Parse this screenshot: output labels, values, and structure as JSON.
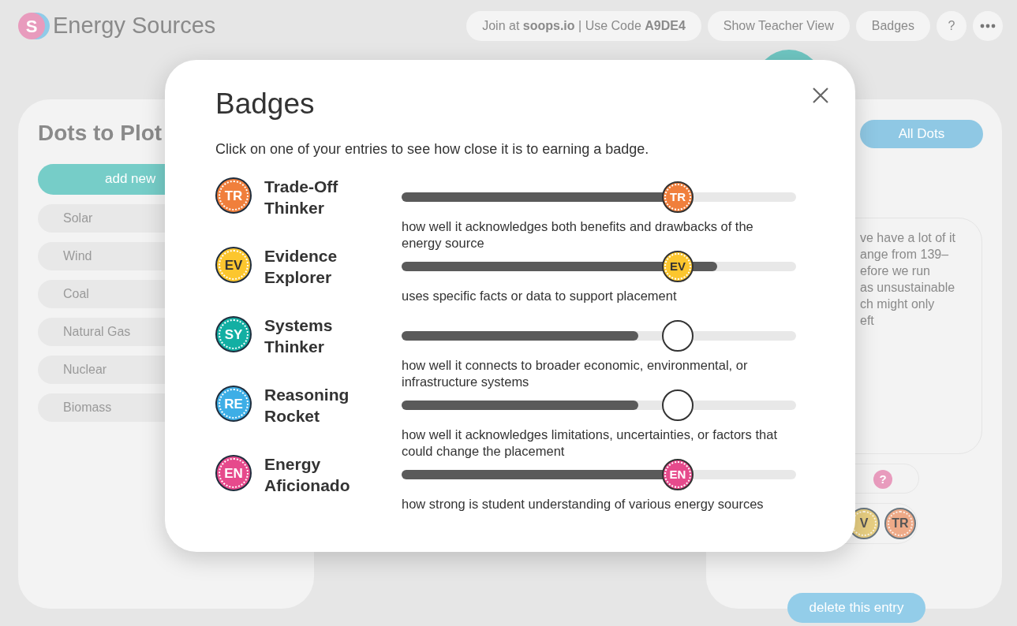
{
  "app": {
    "logo_letter": "S",
    "title": "Energy Sources"
  },
  "header_buttons": [
    {
      "kind": "join",
      "text": "Join at **soops.io** | Use Code **A9DE4**"
    },
    {
      "kind": "pill",
      "text": "Show Teacher View"
    },
    {
      "kind": "pill",
      "text": "Badges"
    },
    {
      "kind": "round",
      "text": "?"
    },
    {
      "kind": "more"
    }
  ],
  "left_panel": {
    "title": "Dots to Plot",
    "add_button": "add new",
    "items": [
      "Solar",
      "Wind",
      "Coal",
      "Natural Gas",
      "Nuclear",
      "Biomass"
    ]
  },
  "right_panel": {
    "filter_button": "All Dots",
    "note_lines": [
      "ve have a lot of it",
      "ange from 139–",
      "efore we run",
      "as unsustainable",
      "ch might only",
      "eft"
    ],
    "help_icon": "?",
    "badge_tokens": [
      {
        "initials": "V",
        "color": "#e8cf82"
      },
      {
        "initials": "TR",
        "color": "#eeaa88"
      }
    ],
    "delete_button": "delete this entry"
  },
  "modal": {
    "title": "Badges",
    "subtitle": "Click on one of your entries to see how close it is to earning a badge.",
    "badges": [
      {
        "initials": "TR",
        "name": "Trade-Off Thinker",
        "color": "#f07f3c",
        "level": 0.7,
        "goal": {
          "level": 0.7,
          "earned": true,
          "text": "TR"
        },
        "description": "how well it acknowledges both benefits and drawbacks of the energy source"
      },
      {
        "initials": "EV",
        "name": "Evidence Explorer",
        "color": "#fcc62e",
        "level": 0.8,
        "goal": {
          "level": 0.7,
          "earned": true,
          "text": "EV"
        },
        "description": "uses specific facts or data to support placement"
      },
      {
        "initials": "SY",
        "name": "Systems Thinker",
        "color": "#13afa3",
        "level": 0.6,
        "goal": {
          "level": 0.7,
          "earned": false
        },
        "description": "how well it connects to broader economic, environmental, or infrastructure systems"
      },
      {
        "initials": "RE",
        "name": "Reasoning Rocket",
        "color": "#3daee6",
        "level": 0.6,
        "goal": {
          "level": 0.7,
          "earned": false
        },
        "description": "how well it acknowledges limitations, uncertainties, or factors that could change the placement"
      },
      {
        "initials": "EN",
        "name": "Energy Aficionado",
        "color": "#e64a8c",
        "level": 0.7,
        "goal": {
          "level": 0.7,
          "earned": true,
          "text": "EN"
        },
        "description": "how strong is student understanding of various energy sources"
      }
    ]
  }
}
